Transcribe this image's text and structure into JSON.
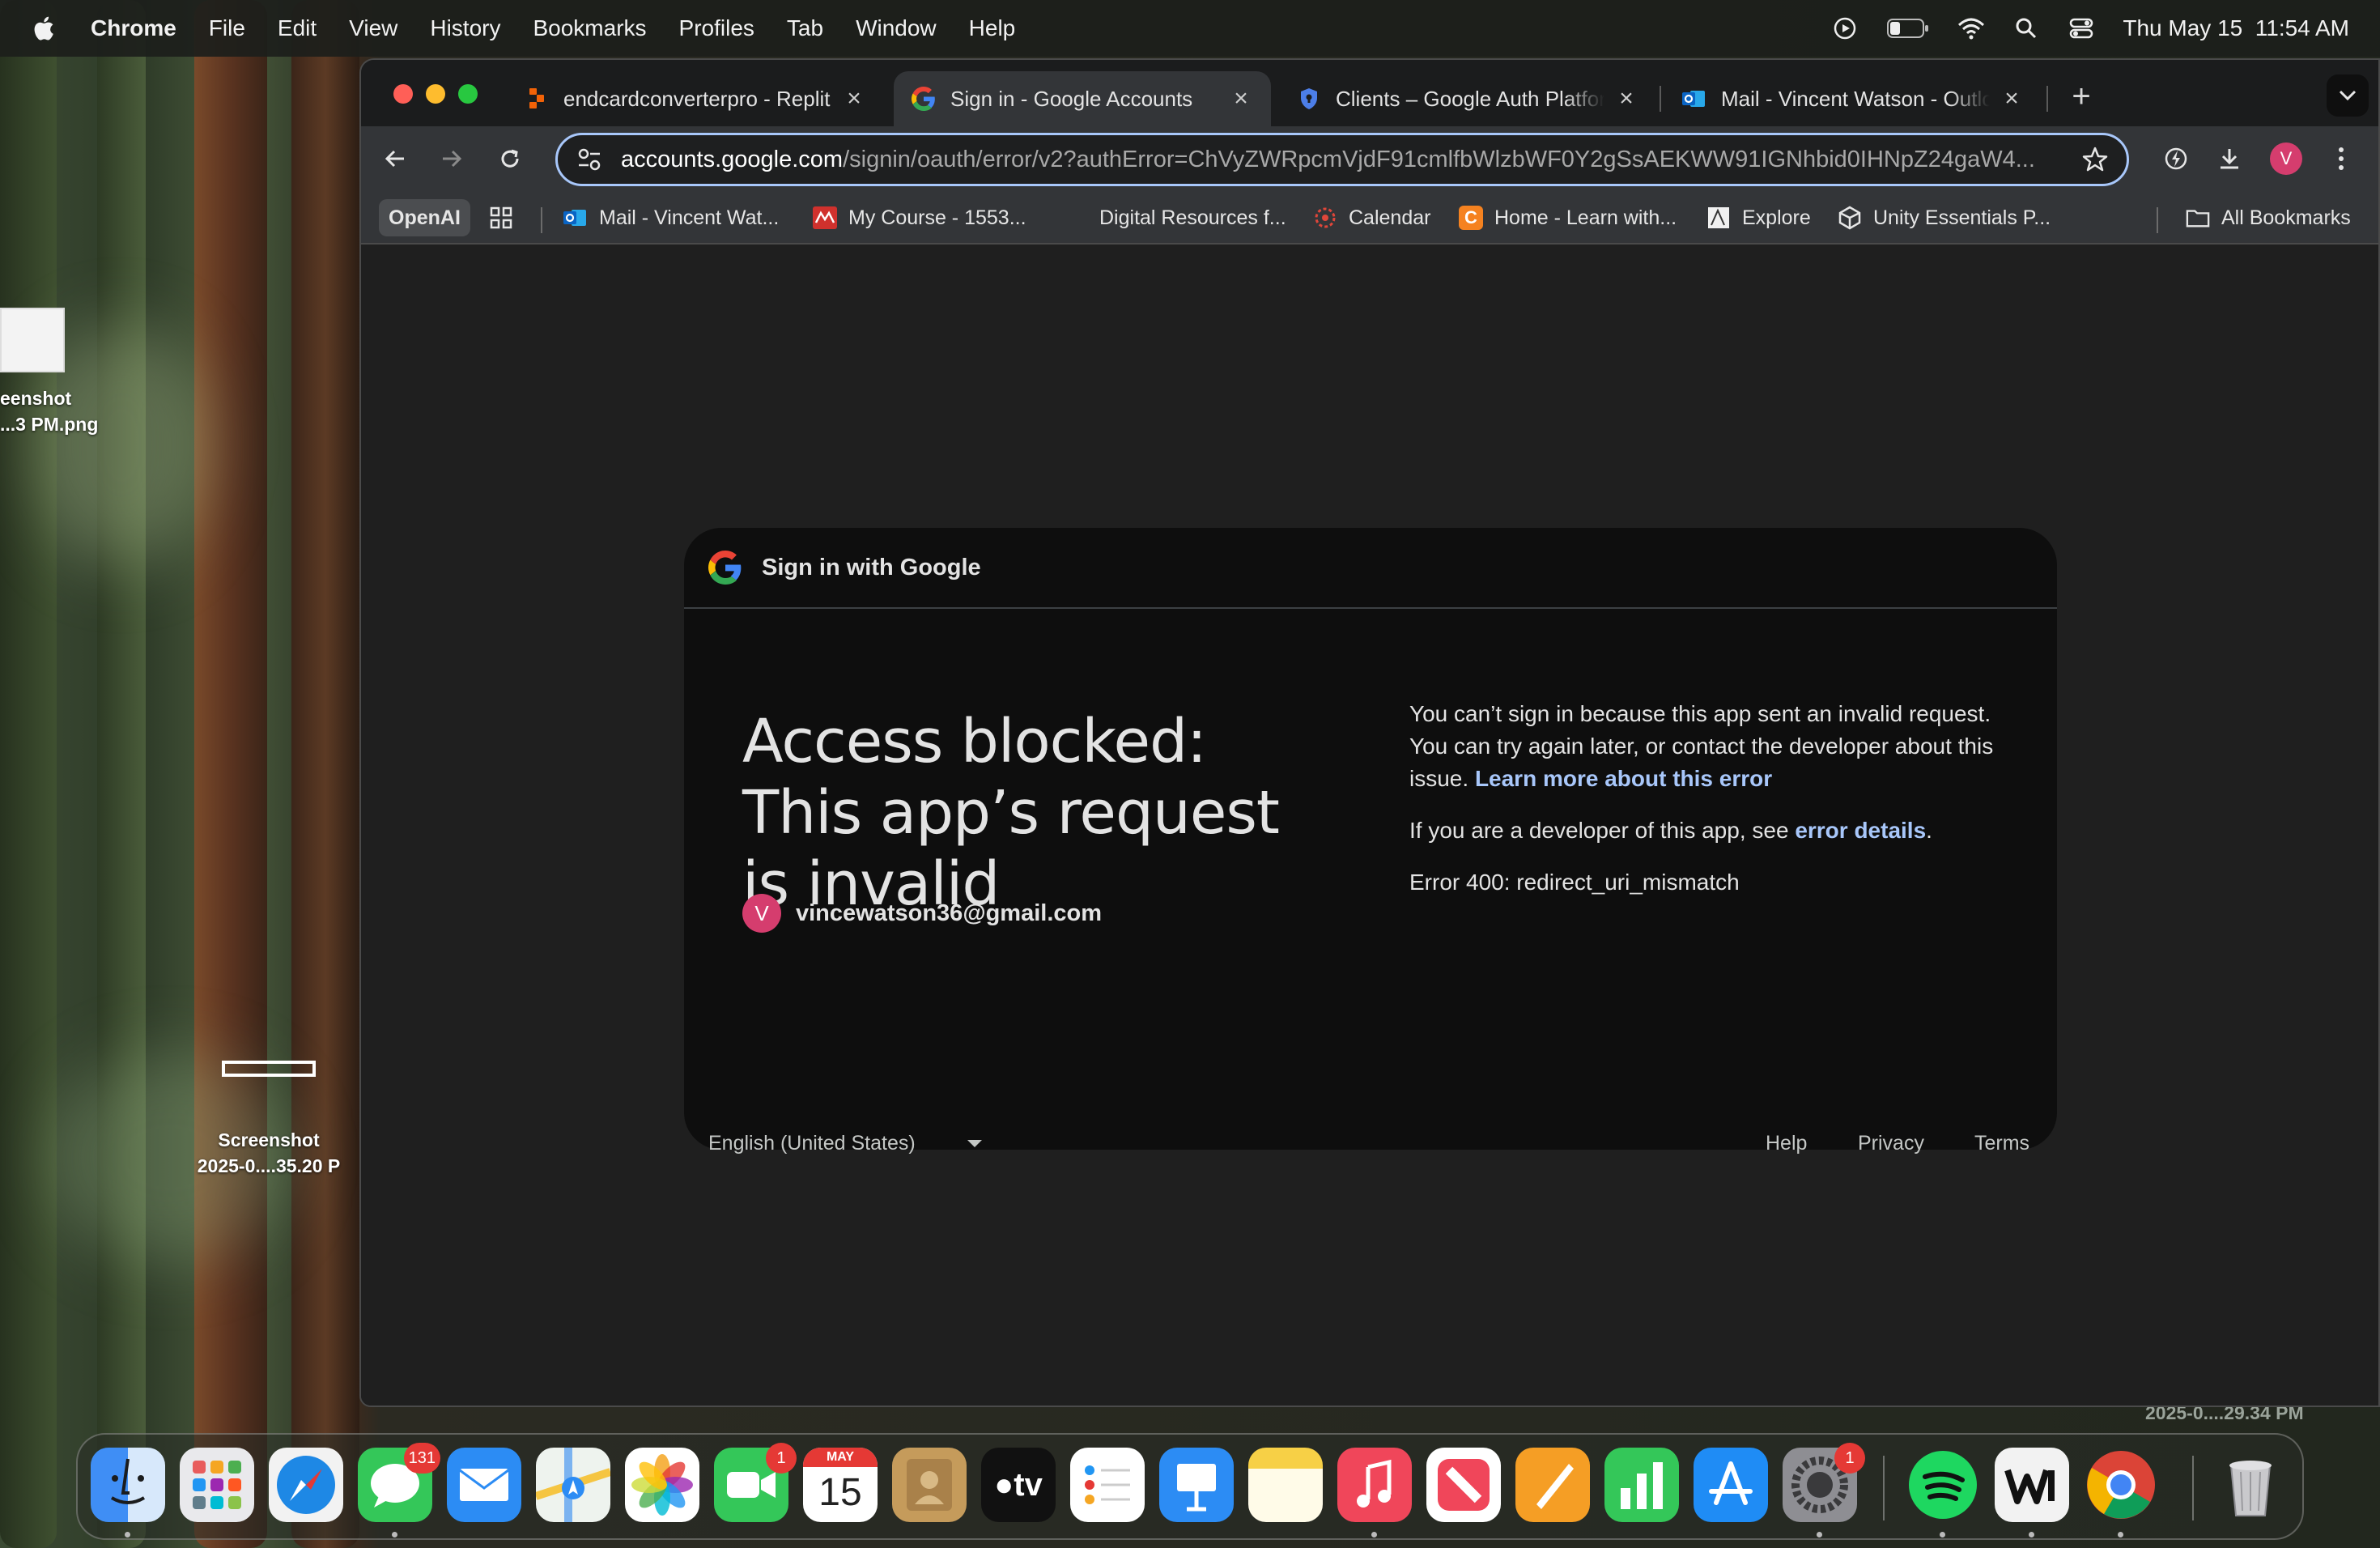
{
  "menubar": {
    "app_name": "Chrome",
    "items": [
      "File",
      "Edit",
      "View",
      "History",
      "Bookmarks",
      "Profiles",
      "Tab",
      "Window",
      "Help"
    ],
    "clock": "Thu May 15  11:54 AM"
  },
  "desktop": {
    "file1": {
      "line1": "eenshot",
      "line2": "...3 PM.png"
    },
    "file2": {
      "line1": "Screenshot",
      "line2": "2025-0....35.20 P"
    },
    "file3_label": "2025-0....29.34 PM"
  },
  "tabs": [
    {
      "title": "endcardconverterpro - Replit",
      "icon": "replit-icon"
    },
    {
      "title": "Sign in - Google Accounts",
      "icon": "google-icon",
      "active": true
    },
    {
      "title": "Clients – Google Auth Platform",
      "icon": "shield-icon"
    },
    {
      "title": "Mail - Vincent Watson - Outlook",
      "icon": "outlook-icon"
    }
  ],
  "omnibox": {
    "host": "accounts.google.com",
    "path": "/signin/oauth/error/v2?authError=ChVyZWRpcmVjdF91cmlfbWlzbWF0Y2gSsAEKWW91IGNhbid0IHNpZ24gaW4..."
  },
  "profile_initial": "V",
  "bookmarks": {
    "openai": "OpenAI",
    "items": [
      "Mail - Vincent Wat...",
      "My Course - 1553...",
      "Digital Resources f...",
      "Calendar",
      "Home - Learn with...",
      "Explore",
      "Unity Essentials P..."
    ],
    "all": "All Bookmarks"
  },
  "card": {
    "header": "Sign in with Google",
    "title": "Access blocked: This app’s request is invalid",
    "account_initial": "V",
    "email": "vincewatson36@gmail.com",
    "desc_part1": "You can’t sign in because this app sent an invalid request. You can try again later, or contact the developer about this issue. ",
    "learn_more": "Learn more about this error",
    "dev_part1": "If you are a developer of this app, see ",
    "error_details": "error details",
    "dev_part2": ".",
    "error_code": "Error 400: redirect_uri_mismatch"
  },
  "footer": {
    "language": "English (United States)",
    "help": "Help",
    "privacy": "Privacy",
    "terms": "Terms"
  },
  "dock": {
    "messages_badge": "131",
    "facetime_badge": "1",
    "calendar_month": "MAY",
    "calendar_day": "15",
    "settings_badge": "1",
    "tv_label": "tv"
  },
  "colors": {
    "accent_link": "#a8c7fa",
    "card_bg": "#0e0e0e",
    "avatar": "#d53d6e"
  }
}
